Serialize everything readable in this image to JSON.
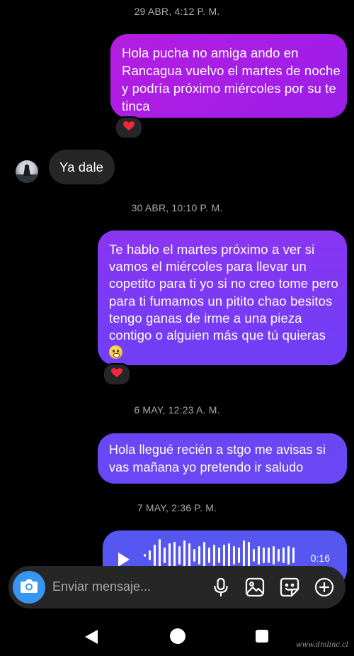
{
  "messages": {
    "ts1": "29 ABR, 4:12 P. M.",
    "msg1": "Hola pucha no amiga ando en Rancagua vuelvo el martes de noche y podría próximo miércoles por su te tinca",
    "msg1_reaction": "❤️",
    "incoming1": "Ya dale",
    "ts2": "30 ABR, 10:10 P. M.",
    "msg2": "Te hablo el martes próximo a ver si vamos el miércoles para llevar un copetito para ti yo si no creo tome pero para ti fumamos un pitito chao besitos  tengo ganas de irme a una pieza contigo o alguien más que tú quieras",
    "msg2_reaction": "❤️",
    "ts3": "6 MAY, 12:23 A. M.",
    "msg3": "Hola llegué recién a stgo me avisas si vas mañana yo pretendo ir saludo",
    "ts4": "7 MAY, 2:36 P. M.",
    "voice_duration": "0:16"
  },
  "composer": {
    "placeholder": "Enviar mensaje...",
    "icons": [
      "camera-icon",
      "microphone-icon",
      "gallery-icon",
      "sticker-icon",
      "plus-circle-icon"
    ]
  },
  "navigation": {
    "icons": [
      "back-icon",
      "home-icon",
      "recents-icon"
    ]
  },
  "watermark": "www.dmlinc.cl",
  "colors": {
    "outgoing_top": "#b51de0",
    "outgoing_mid": "#7a3ef5",
    "outgoing_bottom": "#5656f0",
    "incoming": "#262626",
    "camera_button": "#3797f0"
  }
}
